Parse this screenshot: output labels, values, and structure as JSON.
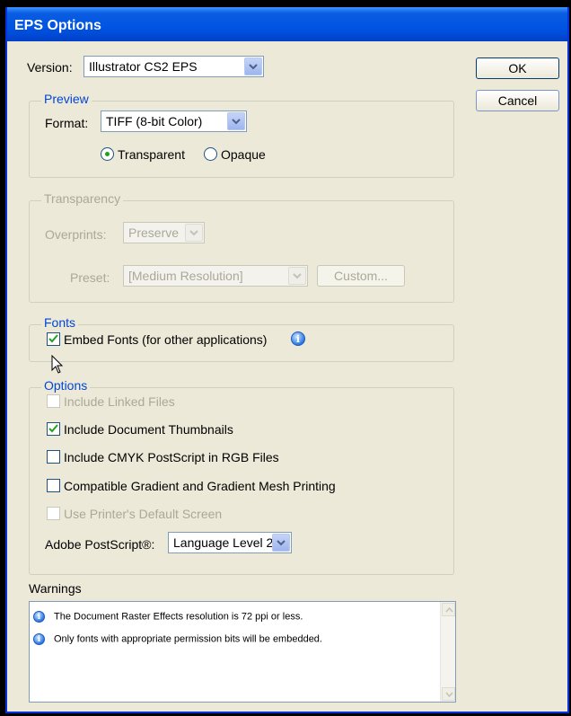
{
  "window": {
    "title": "EPS Options"
  },
  "version": {
    "label": "Version:",
    "value": "Illustrator CS2 EPS"
  },
  "buttons": {
    "ok": "OK",
    "cancel": "Cancel"
  },
  "preview": {
    "legend": "Preview",
    "format_label": "Format:",
    "format_value": "TIFF (8-bit Color)",
    "radio_transparent": "Transparent",
    "radio_opaque": "Opaque",
    "selected": "Transparent"
  },
  "transparency": {
    "legend": "Transparency",
    "overprints_label": "Overprints:",
    "overprints_value": "Preserve",
    "preset_label": "Preset:",
    "preset_value": "[Medium Resolution]",
    "custom_button": "Custom..."
  },
  "fonts": {
    "legend": "Fonts",
    "embed_label": "Embed Fonts (for other applications)",
    "embed_checked": true
  },
  "options": {
    "legend": "Options",
    "include_linked": "Include Linked Files",
    "include_thumbnails": "Include Document Thumbnails",
    "include_cmyk": "Include CMYK PostScript in RGB Files",
    "compatible_gradient": "Compatible Gradient and Gradient Mesh Printing",
    "use_printer_screen": "Use Printer's Default Screen",
    "postscript_label": "Adobe PostScript®:",
    "postscript_value": "Language Level 2"
  },
  "warnings": {
    "label": "Warnings",
    "items": [
      "The Document Raster Effects resolution is 72 ppi or less.",
      "Only fonts with appropriate permission bits will be embedded."
    ]
  },
  "colors": {
    "titlebar": "#0054e3",
    "dialog_bg": "#ece9d8",
    "group_label": "#0046d5",
    "disabled": "#aca899"
  }
}
